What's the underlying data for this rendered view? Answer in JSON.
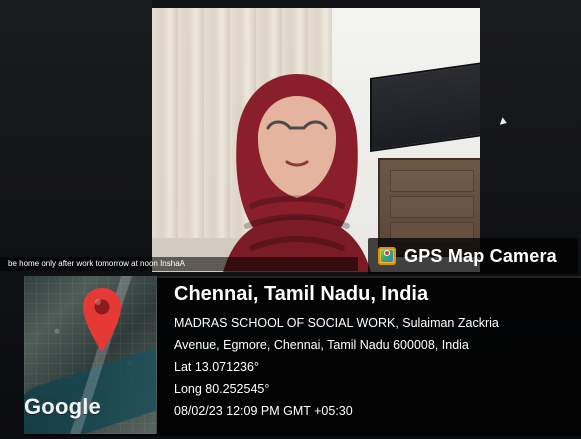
{
  "screen": {
    "caption": "be home only after work tomorrow at noon InshaA"
  },
  "gps_label": {
    "text": "GPS Map Camera",
    "icon": "gps-map-camera-icon"
  },
  "location": {
    "title": "Chennai, Tamil Nadu, India",
    "address_line_1": "MADRAS SCHOOL OF SOCIAL WORK, Sulaiman Zackria",
    "address_line_2": "Avenue, Egmore, Chennai, Tamil Nadu 600008, India",
    "lat": "Lat 13.071236°",
    "long": "Long 80.252545°",
    "datetime": "08/02/23 12:09 PM GMT +05:30"
  },
  "map": {
    "attribution": "Google",
    "pin_icon": "map-pin-icon",
    "pin_color": "#e53935"
  }
}
